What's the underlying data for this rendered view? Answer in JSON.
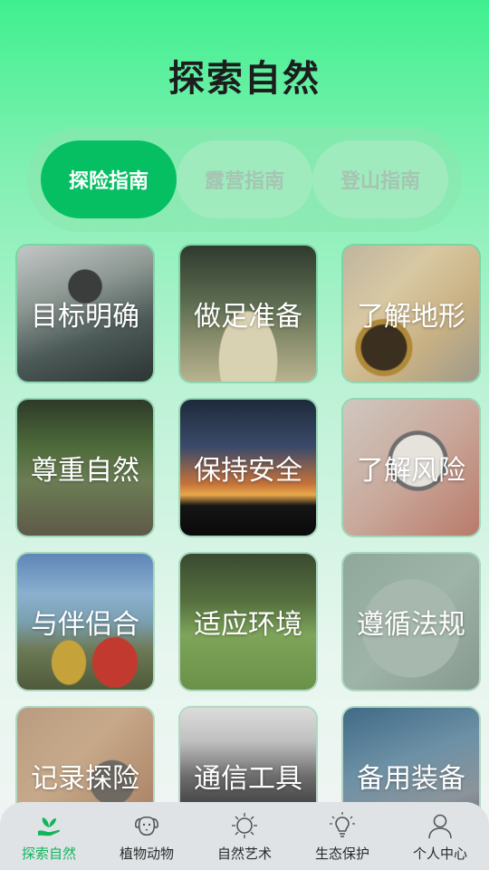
{
  "header": {
    "title": "探索自然"
  },
  "tabs": [
    {
      "label": "探险指南",
      "active": true
    },
    {
      "label": "露营指南",
      "active": false
    },
    {
      "label": "登山指南",
      "active": false
    }
  ],
  "cards": [
    {
      "label": "目标明确"
    },
    {
      "label": "做足准备"
    },
    {
      "label": "了解地形"
    },
    {
      "label": "尊重自然"
    },
    {
      "label": "保持安全"
    },
    {
      "label": "了解风险"
    },
    {
      "label": "与伴侣合"
    },
    {
      "label": "适应环境"
    },
    {
      "label": "遵循法规"
    },
    {
      "label": "记录探险"
    },
    {
      "label": "通信工具"
    },
    {
      "label": "备用装备"
    }
  ],
  "bottom_nav": [
    {
      "label": "探索自然",
      "icon": "sprout-hand-icon",
      "active": true
    },
    {
      "label": "植物动物",
      "icon": "dog-icon",
      "active": false
    },
    {
      "label": "自然艺术",
      "icon": "sun-icon",
      "active": false
    },
    {
      "label": "生态保护",
      "icon": "lightbulb-icon",
      "active": false
    },
    {
      "label": "个人中心",
      "icon": "user-icon",
      "active": false
    }
  ],
  "colors": {
    "accent": "#07bf63",
    "nav_active": "#11b55c"
  }
}
